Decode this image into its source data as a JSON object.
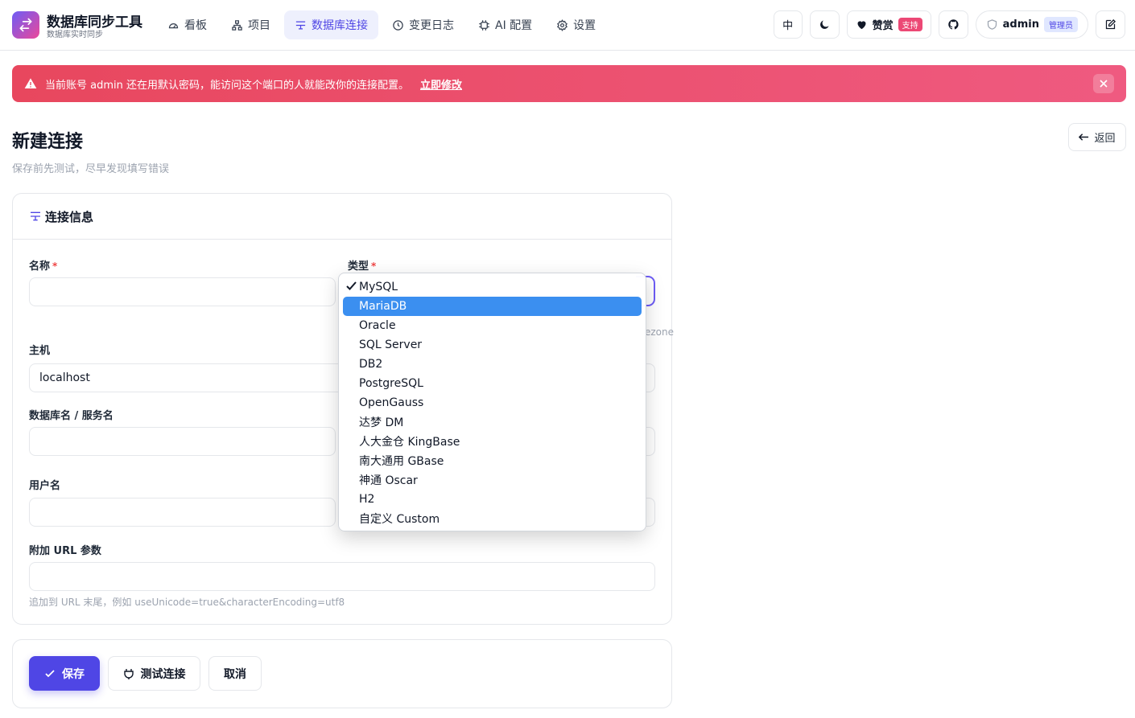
{
  "header": {
    "brand_title": "数据库同步工具",
    "brand_sub": "数据库实时同步",
    "nav": [
      {
        "label": "看板",
        "icon": "gauge-icon"
      },
      {
        "label": "项目",
        "icon": "hierarchy-icon"
      },
      {
        "label": "数据库连接",
        "icon": "database-link-icon",
        "active": true
      },
      {
        "label": "变更日志",
        "icon": "clock-icon"
      },
      {
        "label": "AI 配置",
        "icon": "chip-icon"
      },
      {
        "label": "设置",
        "icon": "gear-icon"
      }
    ],
    "lang_label": "中",
    "sponsor_label": "赞赏",
    "sponsor_badge": "支持",
    "user_name": "admin",
    "user_role": "管理员"
  },
  "alert": {
    "message": "当前账号 admin 还在用默认密码，能访问这个端口的人就能改你的连接配置。",
    "link": "立即修改"
  },
  "page": {
    "title": "新建连接",
    "subtitle": "保存前先测试，尽早发现填写错误",
    "back_label": "返回"
  },
  "form": {
    "section_title": "连接信息",
    "name_label": "名称",
    "type_label": "类型",
    "required_mark": "*",
    "host_label": "主机",
    "host_value": "localhost",
    "db_label": "数据库名 / 服务名",
    "user_label": "用户名",
    "url_label": "附加 URL 参数",
    "url_hint": "追加到 URL 末尾，例如 useUnicode=true&characterEncoding=utf8",
    "bleed_timezone": "ezone"
  },
  "actions": {
    "save_label": "保存",
    "test_label": "测试连接",
    "cancel_label": "取消"
  },
  "type_dropdown": {
    "selected": "MySQL",
    "highlighted": "MariaDB",
    "options": [
      "MySQL",
      "MariaDB",
      "Oracle",
      "SQL Server",
      "DB2",
      "PostgreSQL",
      "OpenGauss",
      "达梦 DM",
      "人大金仓 KingBase",
      "南大通用 GBase",
      "神通 Oscar",
      "H2",
      "自定义 Custom"
    ]
  },
  "colors": {
    "accent": "#4f46e5",
    "alert_start": "#e8475e",
    "alert_end": "#ef5a80",
    "highlight": "#3b8ff0"
  }
}
